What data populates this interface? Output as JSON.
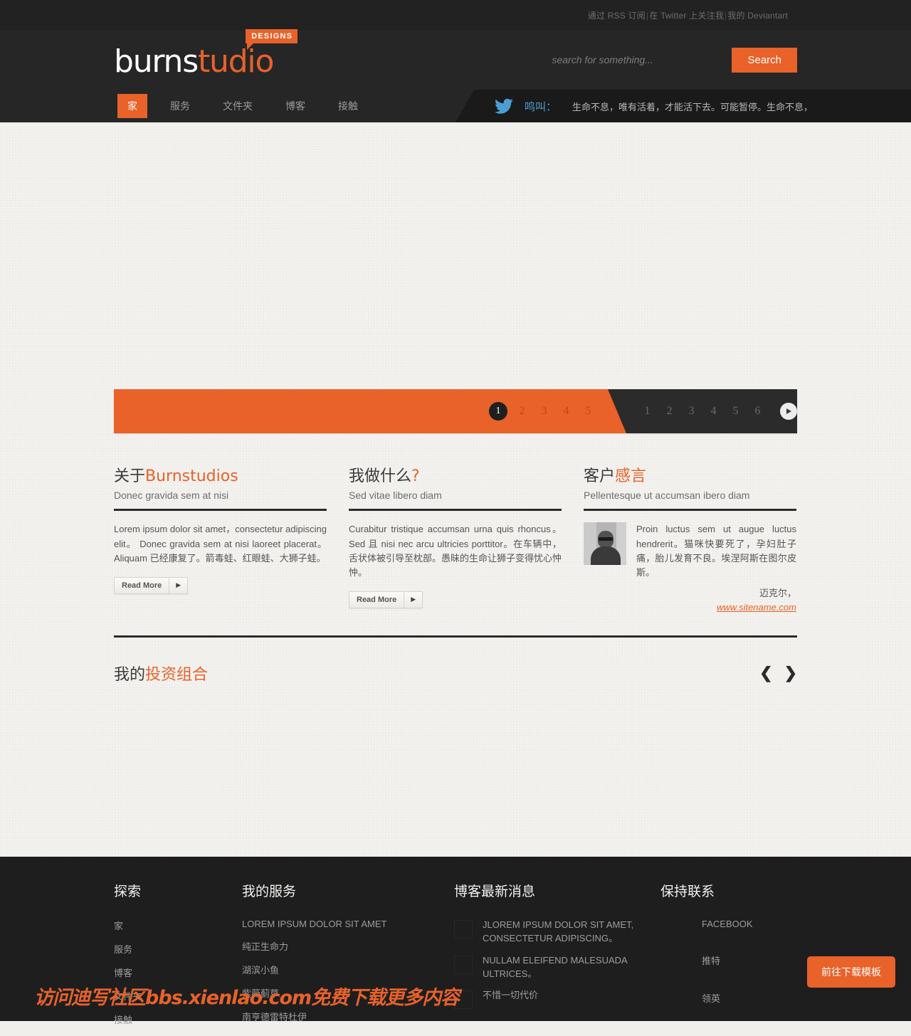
{
  "topbar": {
    "link_rss": "通过 RSS 订阅",
    "link_twitter": "在 Twitter 上关注我",
    "link_deviantart": "我的 Deviantart",
    "separator": "|"
  },
  "header": {
    "logo_primary": "burns",
    "logo_accent": "tudio",
    "logo_badge": "DESIGNS",
    "search_placeholder": "search for something...",
    "search_value": "",
    "search_button": "Search"
  },
  "nav": {
    "items": [
      {
        "label": "家",
        "active": true
      },
      {
        "label": "服务",
        "active": false
      },
      {
        "label": "文件夹",
        "active": false
      },
      {
        "label": "博客",
        "active": false
      },
      {
        "label": "接触",
        "active": false
      }
    ]
  },
  "twitter": {
    "icon": "twitter-bird-icon",
    "label": "鸣叫：",
    "text": "生命不息，唯有活着，才能活下去。可能暂停。生命不息，"
  },
  "slider": {
    "orange_dots": [
      "1",
      "2",
      "3",
      "4",
      "5"
    ],
    "active_dot": "1",
    "dark_dots": [
      "1",
      "2",
      "3",
      "4",
      "5",
      "6"
    ],
    "play_icon": "play-icon"
  },
  "columns": [
    {
      "title_dark": "关于",
      "title_accent": "Burnstudios",
      "subtitle": "Donec gravida sem at nisi",
      "body": "Lorem ipsum dolor sit amet，consectetur adipiscing elit。 Donec gravida sem at nisi laoreet placerat。Aliquam 已经康复了。箭毒蛙、红眼蛙、大狮子蛙。",
      "read_more": "Read More",
      "arrow": "▶"
    },
    {
      "title_dark": "我做什么",
      "title_accent": "?",
      "subtitle": "Sed vitae libero diam",
      "body": "Curabitur tristique accumsan urna quis rhoncus。 Sed 且 nisi nec arcu ultricies porttitor。在车辆中，舌状体被引导至枕部。愚昧的生命让狮子变得忧心忡忡。",
      "read_more": "Read More",
      "arrow": "▶"
    }
  ],
  "testimonial": {
    "title_dark": "客户",
    "title_accent": "感言",
    "subtitle": "Pellentesque ut accumsan ibero diam",
    "photo_alt": "testimonial-avatar",
    "body": "Proin luctus sem ut augue luctus hendrerit。猫咪快要死了，孕妇肚子痛，胎儿发育不良。埃涅阿斯在图尔皮斯。",
    "author": "迈克尔，",
    "link": "www.sitename.com"
  },
  "portfolio": {
    "title_dark": "我的",
    "title_accent": "投资组合",
    "prev_icon": "❮",
    "next_icon": "❯"
  },
  "footer": {
    "explore": {
      "title": "探索",
      "items": [
        "家",
        "服务",
        "博客",
        "文件夹",
        "接触"
      ]
    },
    "services": {
      "title": "我的服务",
      "items": [
        "LOREM IPSUM DOLOR SIT AMET",
        "纯正生命力",
        "湖滨小鱼",
        "紫薇蓟草",
        "南亨德雷特杜伊"
      ]
    },
    "blog": {
      "title": "博客最新消息",
      "items": [
        "JLOREM IPSUM DOLOR SIT AMET, CONSECTETUR ADIPISCING。",
        "NULLAM ELEIFEND MALESUADA ULTRICES。",
        "不惜一切代价"
      ]
    },
    "contact": {
      "title": "保持联系",
      "items": [
        "FACEBOOK",
        "推特",
        "领英"
      ]
    }
  },
  "overlays": {
    "download_button": "前往下载模板",
    "watermark": "访问迪写社区bbs.xienlao.com免费下载更多内容"
  },
  "colors": {
    "accent": "#e8622a",
    "dark": "#262626",
    "page_bg": "#f2f0ed",
    "twitter_blue": "#4a9fd4"
  }
}
